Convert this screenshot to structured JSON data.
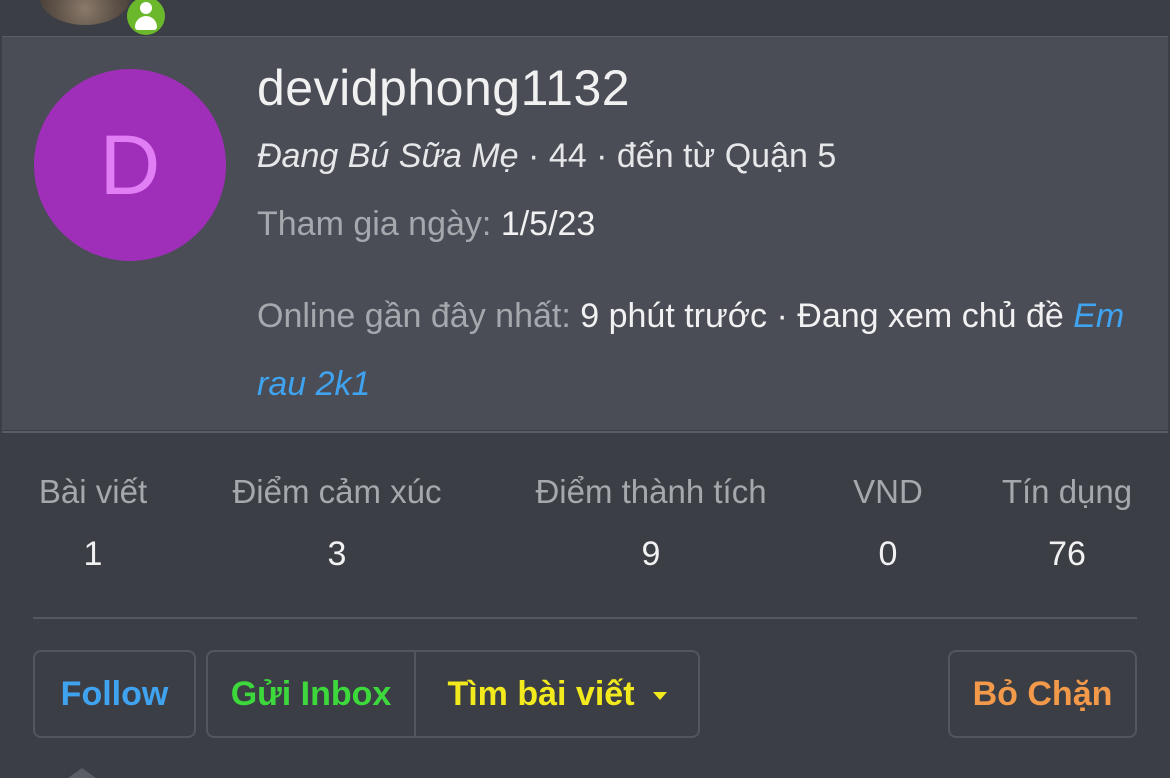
{
  "profile": {
    "avatar_letter": "D",
    "username": "devidphong1132",
    "user_title": "Đang Bú Sữa Mẹ",
    "age": "44",
    "location_prefix": "đến từ",
    "location": "Quận 5",
    "join_label": "Tham gia ngày:",
    "join_date": "1/5/23",
    "last_seen_label": "Online gần đây nhất:",
    "last_seen_time": "9 phút trước",
    "activity": "Đang xem chủ đề",
    "activity_link": "Em rau 2k1"
  },
  "stats": [
    {
      "label": "Bài viết",
      "value": "1"
    },
    {
      "label": "Điểm cảm xúc",
      "value": "3"
    },
    {
      "label": "Điểm thành tích",
      "value": "9"
    },
    {
      "label": "VND",
      "value": "0"
    },
    {
      "label": "Tín dụng",
      "value": "76"
    }
  ],
  "actions": {
    "follow": "Follow",
    "send_inbox": "Gửi Inbox",
    "find_posts": "Tìm bài viết",
    "unblock": "Bỏ Chặn"
  },
  "colors": {
    "avatar_bg": "#9f2fb8",
    "avatar_letter": "#e27ef5",
    "link": "#3fa3f0",
    "follow": "#3fa3f0",
    "inbox": "#3cd83c",
    "find": "#f2ea1d",
    "unblock": "#f2994a",
    "online": "#6cb82d"
  }
}
